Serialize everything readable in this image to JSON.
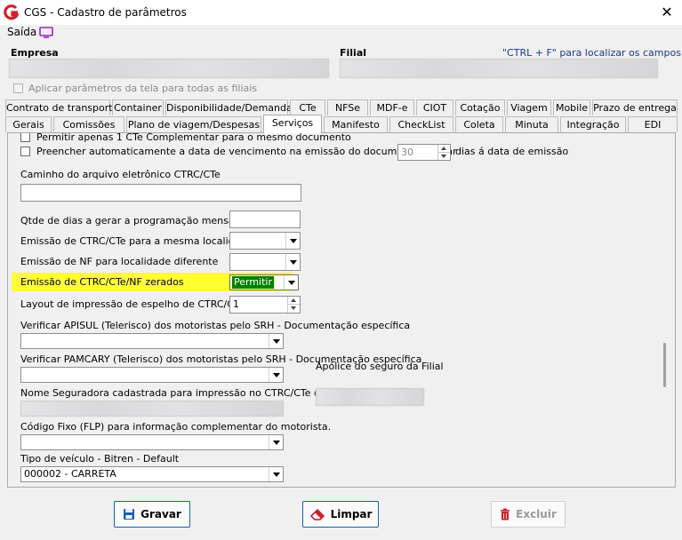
{
  "window": {
    "title": "CGS - Cadastro de parâmetros",
    "close_glyph": "✕"
  },
  "menu": {
    "saida": "Saída"
  },
  "header": {
    "empresa_label": "Empresa",
    "filial_label": "Filial",
    "hint": "\"CTRL + F\" para localizar os campos",
    "apply_all_label": "Aplicar parâmetros da tela para todas as filiais"
  },
  "tabs_row1": [
    "Contrato de transporte",
    "Container",
    "Disponibilidade/Demanda",
    "CTe",
    "NFSe",
    "MDF-e",
    "CIOT",
    "Cotação",
    "Viagem",
    "Mobile",
    "Prazo de entrega"
  ],
  "tabs_row2": [
    "Gerais",
    "Comissões",
    "Plano de viagem/Despesas",
    "Serviços",
    "Manifesto",
    "CheckList",
    "Coleta",
    "Minuta",
    "Integração",
    "EDI"
  ],
  "active_tab": "Serviços",
  "form": {
    "permitir_label": "Permitir apenas 1 CTe Complementar para o mesmo documento",
    "preencher_label": "Preencher automaticamente a data de vencimento na emissão do documento. Somar",
    "preencher_days_value": "30",
    "preencher_suffix": "dias á data de emissão",
    "caminho_label": "Caminho do arquivo eletrônico CTRC/CTe",
    "caminho_value": "",
    "qtde_label": "Qtde de dias a gerar a programação mensal",
    "qtde_value": "",
    "emissao_mesma_label": "Emissão de CTRC/CTe para a mesma localidade",
    "emissao_mesma_value": "",
    "emissao_nf_label": "Emissão de NF para localidade diferente",
    "emissao_nf_value": "",
    "emissao_zerados_label": "Emissão de CTRC/CTe/NF zerados",
    "emissao_zerados_value": "Permitir",
    "layout_label": "Layout de impressão de espelho de CTRC/CT-e",
    "layout_value": "1",
    "apisul_label": "Verificar APISUL (Telerisco) dos motoristas pelo SRH - Documentação específica",
    "apisul_value": "",
    "pamcary_label": "Verificar PAMCARY (Telerisco) dos motoristas pelo SRH - Documentação específica",
    "pamcary_value": "",
    "apolice_label": "Apólice do seguro da Filial",
    "seguradora_label": "Nome Seguradora cadastrada para impressão no CTRC/CTe da Filial",
    "codigo_fixo_label": "Código Fixo (FLP) para informação complementar do motorista.",
    "codigo_fixo_value": "",
    "tipo_veiculo_label": "Tipo de veículo - Bitren - Default",
    "tipo_veiculo_value": "000002 - CARRETA"
  },
  "buttons": {
    "gravar": "Gravar",
    "limpar": "Limpar",
    "excluir": "Excluir"
  },
  "colors": {
    "highlight": "#ffff33",
    "selected_bg": "#008000",
    "accent": "#1a5fb4",
    "logo_red": "#d0202a"
  }
}
